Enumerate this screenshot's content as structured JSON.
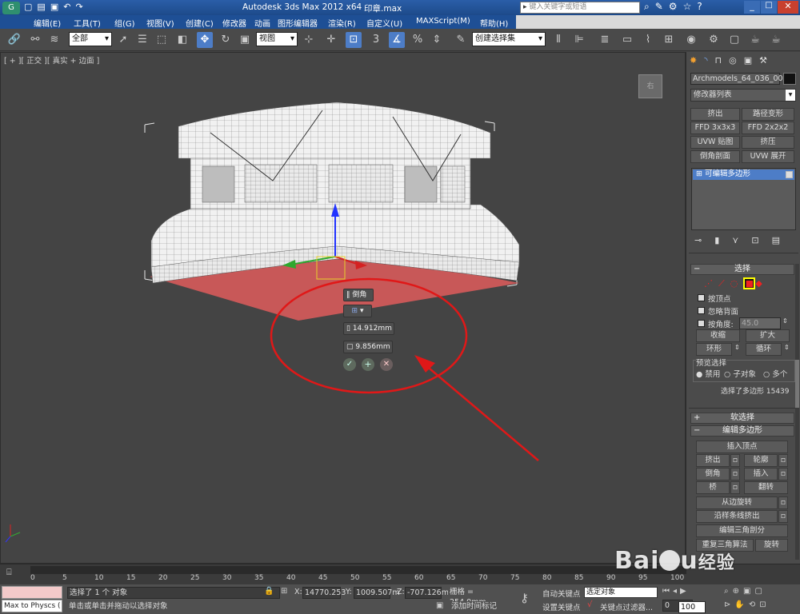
{
  "title": {
    "app": "Autodesk 3ds Max  2012 x64",
    "file": "印章.max",
    "search_placeholder": "键入关键字或短语"
  },
  "menu": [
    "编辑(E)",
    "工具(T)",
    "组(G)",
    "视图(V)",
    "创建(C)",
    "修改器",
    "动画",
    "图形编辑器",
    "渲染(R)",
    "自定义(U)",
    "MAXScript(M)",
    "帮助(H)"
  ],
  "toolbar": {
    "filter": "全部",
    "ref_coord": "视图",
    "snap_label": "3",
    "selection_set": "创建选择集"
  },
  "viewport": {
    "label": "[ + ][ 正交 ][ 真实 + 边面 ]",
    "viewcube_label": "右"
  },
  "caddy": {
    "title": "倒角",
    "height": "14.912mm",
    "outline": "9.856mm"
  },
  "panel": {
    "object_name": "Archmodels_64_036_002",
    "modifier_list": "修改器列表",
    "modifier_buttons": [
      "挤出",
      "路径变形",
      "FFD 3x3x3",
      "FFD 2x2x2",
      "UVW 贴图",
      "挤压",
      "倒角剖面",
      "UVW 展开"
    ],
    "stack_item": "可编辑多边形",
    "selection": {
      "header": "选择",
      "by_vertex": "按顶点",
      "ignore_backface": "忽略背面",
      "by_angle": "按角度:",
      "angle_value": "45.0",
      "shrink": "收缩",
      "grow": "扩大",
      "ring": "环形",
      "loop": "循环",
      "preview_label": "预览选择",
      "preview_options": [
        "禁用",
        "子对象",
        "多个"
      ],
      "status": "选择了多边形 15439"
    },
    "soft_selection": "软选择",
    "edit_polygons": {
      "header": "编辑多边形",
      "insert_vertex": "插入顶点",
      "extrude": "挤出",
      "outline": "轮廓",
      "bevel": "倒角",
      "inset": "插入",
      "bridge": "桥",
      "flip": "翻转",
      "hinge": "从边旋转",
      "extrude_spline": "沿样条线挤出",
      "edit_tri": "编辑三角剖分",
      "retriangulate": "重复三角算法",
      "turn": "旋转"
    }
  },
  "timeline": {
    "frame": "0 / 100",
    "ticks": [
      "0",
      "5",
      "10",
      "15",
      "20",
      "25",
      "30",
      "35",
      "40",
      "45",
      "50",
      "55",
      "60",
      "65",
      "70",
      "75",
      "80",
      "85",
      "90",
      "95",
      "100"
    ]
  },
  "status": {
    "maxscript": "Max to Physcs (",
    "selected": "选择了 1 个 对象",
    "prompt": "单击或单击并拖动以选择对象",
    "x_label": "X:",
    "x": "14770.253",
    "y_label": "Y:",
    "y": "1009.507m",
    "z_label": "Z:",
    "z": "-707.126m",
    "grid": "栅格 = 254.0mm",
    "add_time_tag": "添加时间标记",
    "auto_key": "自动关键点",
    "selected_dropdown": "选定对象",
    "set_key": "设置关键点",
    "key_filters": "关键点过滤器...",
    "frame_field": "0",
    "spinner_100": "100"
  }
}
